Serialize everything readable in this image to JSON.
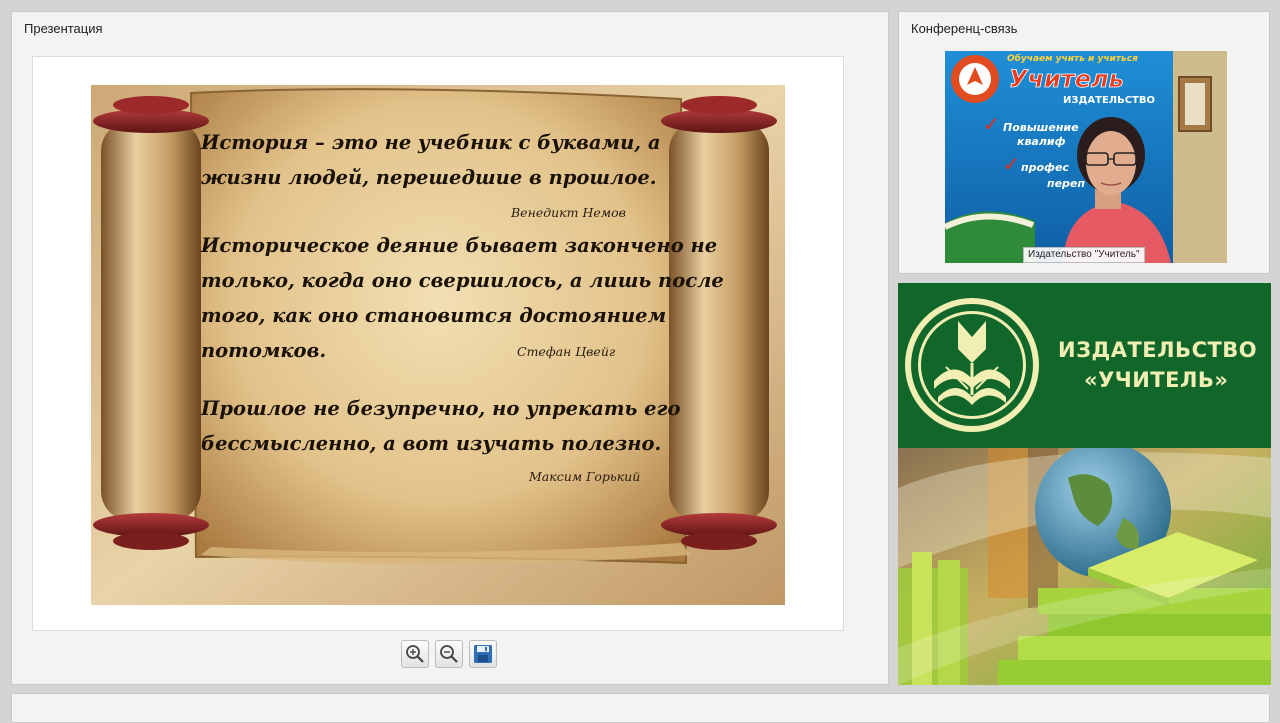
{
  "presentation": {
    "title": "Презентация",
    "quotes": [
      {
        "lines": [
          "История – это не учебник  с буквами, а",
          "жизни людей, перешедшие в прошлое."
        ],
        "author": "Венедикт  Немов"
      },
      {
        "lines": [
          "Историческое деяние бывает закончено не",
          "только, когда оно свершилось, а лишь после",
          "того, как оно становится достоянием",
          "потомков."
        ],
        "author": "Стефан Цвейг"
      },
      {
        "lines": [
          "Прошлое не безупречно, но упрекать его",
          "бессмысленно, а вот изучать полезно."
        ],
        "author": "Максим Горький"
      }
    ],
    "toolbar": {
      "zoom_in": "zoom-in-icon",
      "zoom_out": "zoom-out-icon",
      "save": "save-icon"
    }
  },
  "conference": {
    "title": "Конференц-связь",
    "video_caption": "Издательство \"Учитель\"",
    "background_banner": {
      "top_text": "Обучаем учить и учиться",
      "brand": "Учитель",
      "brand_sub": "ИЗДАТЕЛЬСТВО",
      "items": [
        "Повышение",
        "квалиф",
        "профес",
        "переп"
      ]
    }
  },
  "publisher": {
    "line1": "ИЗДАТЕЛЬСТВО",
    "line2": "«УЧИТЕЛЬ»"
  },
  "colors": {
    "banner_green": "#11672a",
    "banner_text": "#f1eeb3",
    "scroll_parchment": "#e2c894",
    "scroll_roller": "#8b2222"
  }
}
